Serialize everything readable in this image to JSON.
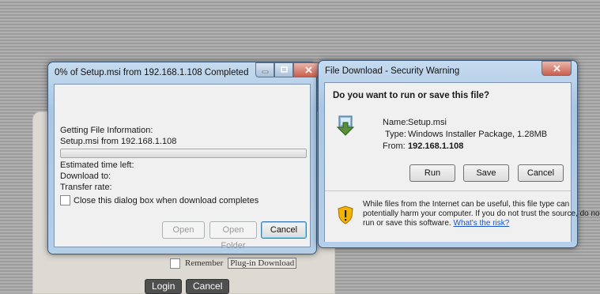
{
  "background": {
    "remember_label": "Remember",
    "plugin_download_label": "Plug-in Download",
    "login_button": "Login",
    "cancel_button": "Cancel"
  },
  "download_dialog": {
    "title": "0% of Setup.msi from 192.168.1.108 Completed",
    "getting_info": "Getting File Information:",
    "file_source": "Setup.msi from 192.168.1.108",
    "progress_percent": 0,
    "estimated_time": "Estimated time left:",
    "download_to": "Download to:",
    "transfer_rate": "Transfer rate:",
    "close_checkbox_label": "Close this dialog box when download completes",
    "open_button": "Open",
    "open_folder_button": "Open Folder",
    "cancel_button": "Cancel"
  },
  "security_dialog": {
    "title": "File Download - Security Warning",
    "question": "Do you want to run or save this file?",
    "name_label": "Name:",
    "name_value": "Setup.msi",
    "type_label": "Type:",
    "type_value": "Windows Installer Package, 1.28MB",
    "from_label": "From:",
    "from_value": "192.168.1.108",
    "run_button": "Run",
    "save_button": "Save",
    "cancel_button": "Cancel",
    "warning_text_1": "While files from the Internet can be useful, this file type can",
    "warning_text_2": "potentially harm your computer. If you do not trust the source, do not",
    "warning_text_3": "run or save this software.",
    "risk_link": "What's the risk?"
  },
  "icons": [
    "minimize-icon",
    "maximize-icon",
    "close-icon",
    "installer-icon",
    "shield-warning-icon"
  ]
}
